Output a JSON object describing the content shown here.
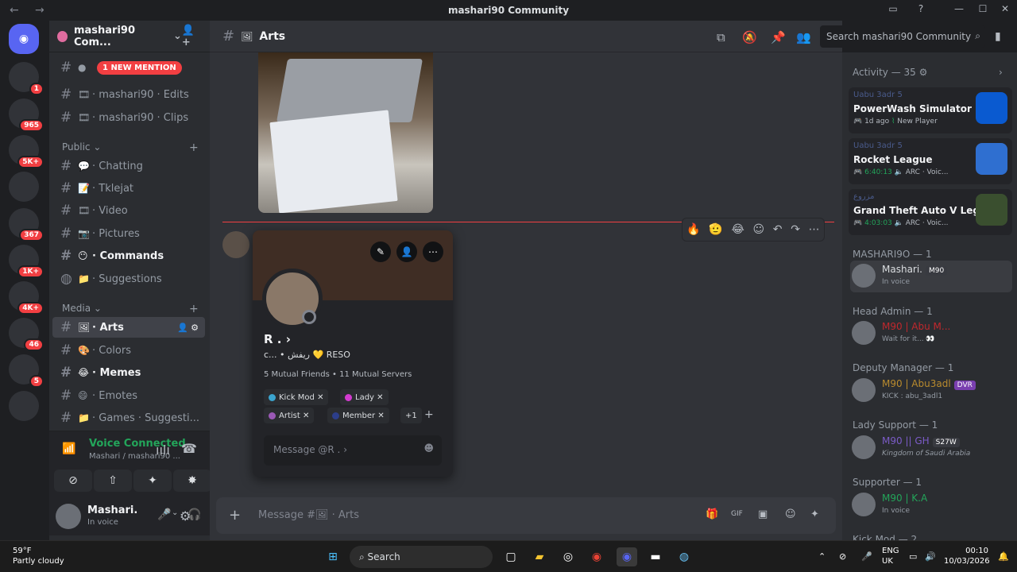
{
  "window": {
    "title": "mashari90 Community",
    "back": "←",
    "forward": "→"
  },
  "servers": {
    "badges": [
      "1",
      "965",
      "5K+",
      "367",
      "1K+",
      "4K+",
      "46",
      "5"
    ]
  },
  "guild": {
    "name": "mashari90 Com...",
    "mention": "1 NEW MENTION"
  },
  "channels": {
    "top": [
      {
        "label": "· mashari90 · Edits"
      },
      {
        "label": "· mashari90 · Clips"
      }
    ],
    "public_label": "Public",
    "public": [
      {
        "label": "· Chatting",
        "emoji": "💬"
      },
      {
        "label": "· Tklejat",
        "emoji": "📝"
      },
      {
        "label": "· Video",
        "emoji": "🎞"
      },
      {
        "label": "· Pictures",
        "emoji": "📷"
      },
      {
        "label": "· Commands",
        "emoji": "😶"
      },
      {
        "label": "· Suggestions",
        "emoji": "📁"
      }
    ],
    "media_label": "Media",
    "media": [
      {
        "label": "· Arts",
        "emoji": "🖼"
      },
      {
        "label": "· Colors",
        "emoji": "🎨"
      },
      {
        "label": "· Memes",
        "emoji": "😂"
      },
      {
        "label": "· Emotes",
        "emoji": "😄"
      },
      {
        "label": "· Games · Suggesti...",
        "emoji": "📁"
      }
    ]
  },
  "voice": {
    "status": "Voice Connected",
    "location": "Mashari / mashari90 ..."
  },
  "user": {
    "name": "Mashari.",
    "status": "In voice"
  },
  "header": {
    "channel": "Arts",
    "search_placeholder": "Search mashari90 Community"
  },
  "popout": {
    "name": "R . ›",
    "tagline": "c... • ريفش 💛 RESO",
    "mutual_friends": "5 Mutual Friends",
    "mutual_servers": "11 Mutual Servers",
    "roles": [
      {
        "name": "Kick Mod",
        "color": "#3ba5d0"
      },
      {
        "name": "Lady",
        "color": "#d33bd0"
      },
      {
        "name": "Artist",
        "color": "#9b59b6"
      },
      {
        "name": "Member",
        "color": "#2c3e8a"
      }
    ],
    "more_roles": "+1",
    "message_placeholder": "Message @R . ›"
  },
  "composer": {
    "placeholder": "Message #🖼 · Arts"
  },
  "members": {
    "activity_header": "Activity — 35",
    "activities": [
      {
        "sub": "Uabu 3adr 5",
        "game": "PowerWash Simulator",
        "time": "1d ago",
        "extra": "New Player",
        "color": "#0a5ad0"
      },
      {
        "sub": "Uabu 3adr 5",
        "game": "Rocket League",
        "time": "6:40:13",
        "extra": "ARC · Voic...",
        "color": "#2f6fd0"
      },
      {
        "sub": "مزروع",
        "game": "Grand Theft Auto V Legacy",
        "time": "4:03:03",
        "extra": "ARC · Voic...",
        "color": "#3a4f2f"
      }
    ],
    "groups": [
      {
        "header": "MASHARI9O — 1",
        "name": "Mashari.",
        "tag": "M90",
        "status": "In voice",
        "color": "#dbdee1"
      },
      {
        "header": "Head Admin — 1",
        "name": "M90 | Abu M...",
        "tag": "",
        "status": "Wait for it... 👀",
        "color": "#c0282d"
      },
      {
        "header": "Deputy Manager — 1",
        "name": "M90 | Abu3adl",
        "tag": "DVR",
        "status": "KICK : abu_3adl1",
        "color": "#b98b2e"
      },
      {
        "header": "Lady Support — 1",
        "name": "M90 || GH",
        "tag": "S27W",
        "status": "Kingdom of Saudi Arabia",
        "color": "#7b5bc7"
      },
      {
        "header": "Supporter — 1",
        "name": "M90 | K.A",
        "tag": "",
        "status": "In voice",
        "color": "#23a55a"
      }
    ],
    "kick_header": "Kick Mod — 2"
  },
  "taskbar": {
    "temp": "59°F",
    "weather": "Partly cloudy",
    "search": "Search",
    "lang": "ENG",
    "region": "UK",
    "time": "00:10",
    "date": "10/03/2026"
  }
}
